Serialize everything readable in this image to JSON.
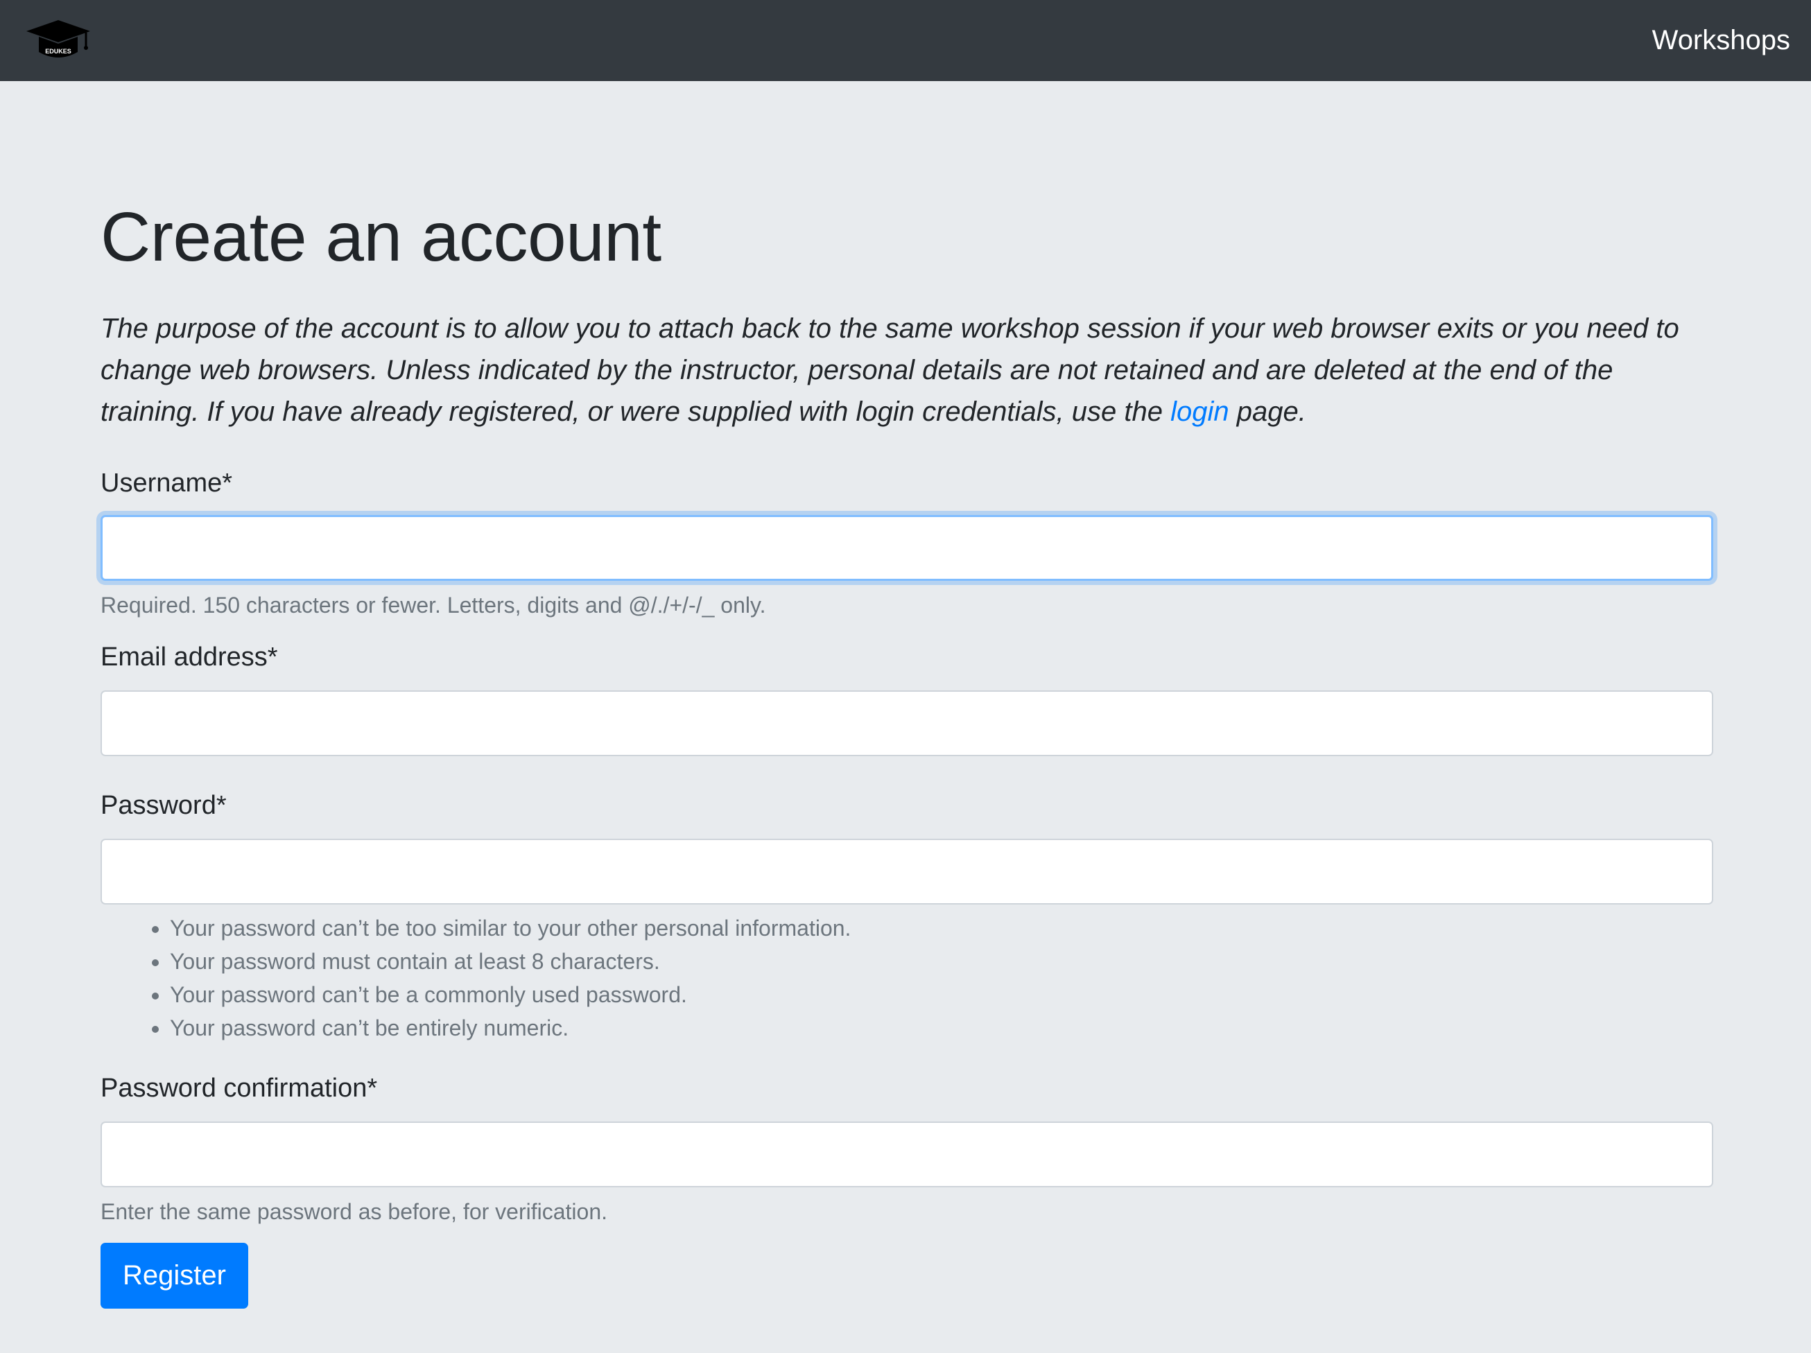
{
  "navbar": {
    "logo_text": "EDUKES",
    "workshops_link": "Workshops"
  },
  "page": {
    "title": "Create an account",
    "intro_text": "The purpose of the account is to allow you to attach back to the same workshop session if your web browser exits or you need to change web browsers. Unless indicated by the instructor, personal details are not retained and are deleted at the end of the training. If you have already registered, or were supplied with login credentials, use the ",
    "login_link": "login",
    "intro_suffix": " page."
  },
  "form": {
    "username": {
      "label": "Username*",
      "value": "",
      "help": "Required. 150 characters or fewer. Letters, digits and @/./+/-/_ only."
    },
    "email": {
      "label": "Email address*",
      "value": ""
    },
    "password": {
      "label": "Password*",
      "value": "",
      "help_items": [
        "Your password can’t be too similar to your other personal information.",
        "Your password must contain at least 8 characters.",
        "Your password can’t be a commonly used password.",
        "Your password can’t be entirely numeric."
      ]
    },
    "password_confirmation": {
      "label": "Password confirmation*",
      "value": "",
      "help": "Enter the same password as before, for verification."
    },
    "submit_label": "Register"
  },
  "colors": {
    "navbar_bg": "#343a40",
    "page_bg": "#e8ebee",
    "primary": "#007bff",
    "focus_border": "#80bdff",
    "muted_text": "#6c757d"
  }
}
